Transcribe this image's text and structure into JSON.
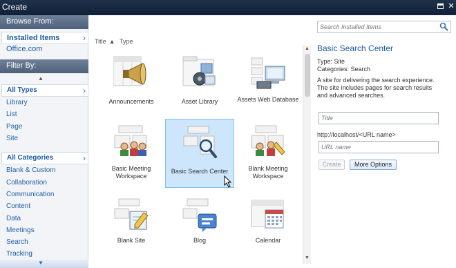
{
  "window": {
    "title": "Create"
  },
  "left": {
    "browse_header": "Browse From:",
    "installed_items": "Installed Items",
    "office_com": "Office.com",
    "filter_header": "Filter By:",
    "all_types": "All Types",
    "types": [
      "Library",
      "List",
      "Page",
      "Site"
    ],
    "all_categories": "All Categories",
    "categories": [
      "Blank & Custom",
      "Collaboration",
      "Communication",
      "Content",
      "Data",
      "Meetings",
      "Search",
      "Tracking"
    ]
  },
  "sort": {
    "title": "Title",
    "type": "Type"
  },
  "items": [
    {
      "label": "Announcements",
      "icon": "announcements-megaphone-icon"
    },
    {
      "label": "Asset Library",
      "icon": "asset-library-icon"
    },
    {
      "label": "Assets Web Database",
      "icon": "web-database-icon"
    },
    {
      "label": "Basic Meeting Workspace",
      "icon": "meeting-workspace-icon"
    },
    {
      "label": "Basic Search Center",
      "icon": "search-center-icon",
      "selected": true
    },
    {
      "label": "Blank Meeting Workspace",
      "icon": "blank-meeting-workspace-icon"
    },
    {
      "label": "Blank Site",
      "icon": "blank-site-icon"
    },
    {
      "label": "Blog",
      "icon": "blog-icon"
    },
    {
      "label": "Calendar",
      "icon": "calendar-icon"
    }
  ],
  "search": {
    "placeholder": "Search Installed Items"
  },
  "detail": {
    "title": "Basic Search Center",
    "type_line": "Type: Site",
    "categories_line": "Categories: Search",
    "description": "A site for delivering the search experience. The site includes pages for search results and advanced searches.",
    "title_placeholder": "Title",
    "url_label": "http://localhost/<URL name>",
    "url_placeholder": "URL name",
    "create_label": "Create",
    "more_options_label": "More Options"
  },
  "colors": {
    "accent": "#1b5aa6",
    "selection": "#cde6fb",
    "titlebar": "#1a2b44"
  }
}
